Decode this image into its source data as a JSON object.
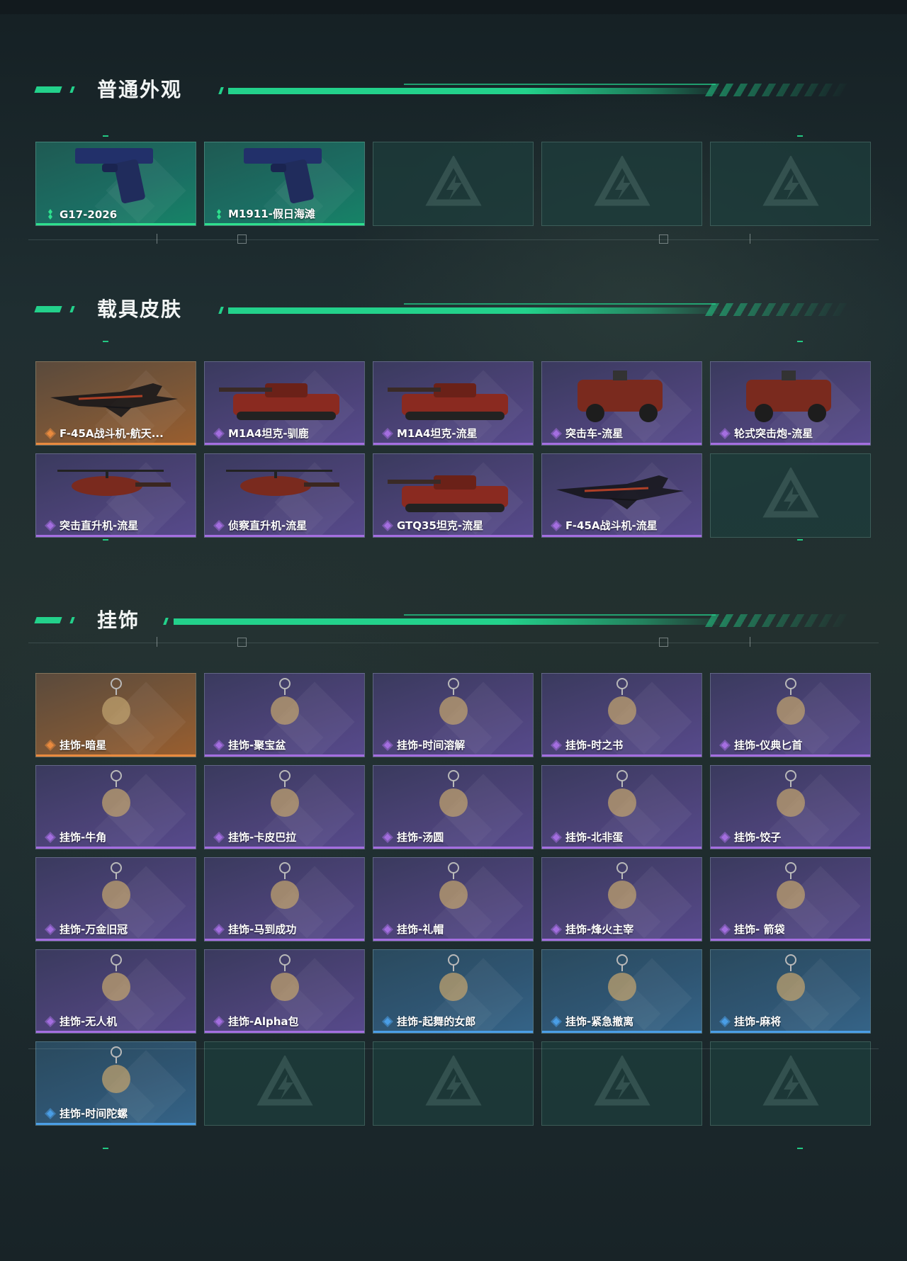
{
  "sections": [
    {
      "title": "普通外观",
      "items": [
        {
          "label": "G17-2026",
          "rarity": "green",
          "icon": "pistol-icon"
        },
        {
          "label": "M1911-假日海滩",
          "rarity": "green",
          "icon": "pistol-icon"
        }
      ],
      "empty_slots": 3
    },
    {
      "title": "载具皮肤",
      "items": [
        {
          "label": "F-45A战斗机-航天...",
          "rarity": "orange",
          "icon": "jet-icon"
        },
        {
          "label": "M1A4坦克-驯鹿",
          "rarity": "purple",
          "icon": "tank-icon"
        },
        {
          "label": "M1A4坦克-流星",
          "rarity": "purple",
          "icon": "tank-icon"
        },
        {
          "label": "突击车-流星",
          "rarity": "purple",
          "icon": "armored-car-icon"
        },
        {
          "label": "轮式突击炮-流星",
          "rarity": "purple",
          "icon": "armored-car-icon"
        },
        {
          "label": "突击直升机-流星",
          "rarity": "purple",
          "icon": "helicopter-icon"
        },
        {
          "label": "侦察直升机-流星",
          "rarity": "purple",
          "icon": "helicopter-icon"
        },
        {
          "label": "GTQ35坦克-流星",
          "rarity": "purple",
          "icon": "tank-icon"
        },
        {
          "label": "F-45A战斗机-流星",
          "rarity": "purple",
          "icon": "jet-icon"
        }
      ],
      "empty_slots": 1
    },
    {
      "title": "挂饰",
      "items": [
        {
          "label": "挂饰-暗星",
          "rarity": "orange",
          "icon": "charm-icon"
        },
        {
          "label": "挂饰-聚宝盆",
          "rarity": "purple",
          "icon": "charm-icon"
        },
        {
          "label": "挂饰-时间溶解",
          "rarity": "purple",
          "icon": "charm-icon"
        },
        {
          "label": "挂饰-时之书",
          "rarity": "purple",
          "icon": "charm-icon"
        },
        {
          "label": "挂饰-仪典匕首",
          "rarity": "purple",
          "icon": "charm-icon"
        },
        {
          "label": "挂饰-牛角",
          "rarity": "purple",
          "icon": "charm-icon"
        },
        {
          "label": "挂饰-卡皮巴拉",
          "rarity": "purple",
          "icon": "charm-icon"
        },
        {
          "label": "挂饰-汤圆",
          "rarity": "purple",
          "icon": "charm-icon"
        },
        {
          "label": "挂饰-北非蛋",
          "rarity": "purple",
          "icon": "charm-icon"
        },
        {
          "label": "挂饰-饺子",
          "rarity": "purple",
          "icon": "charm-icon"
        },
        {
          "label": "挂饰-万金旧冠",
          "rarity": "purple",
          "icon": "charm-icon"
        },
        {
          "label": "挂饰-马到成功",
          "rarity": "purple",
          "icon": "charm-icon"
        },
        {
          "label": "挂饰-礼帽",
          "rarity": "purple",
          "icon": "charm-icon"
        },
        {
          "label": "挂饰-烽火主宰",
          "rarity": "purple",
          "icon": "charm-icon"
        },
        {
          "label": "挂饰- 箭袋",
          "rarity": "purple",
          "icon": "charm-icon"
        },
        {
          "label": "挂饰-无人机",
          "rarity": "purple",
          "icon": "charm-icon"
        },
        {
          "label": "挂饰-Alpha包",
          "rarity": "purple",
          "icon": "charm-icon"
        },
        {
          "label": "挂饰-起舞的女郎",
          "rarity": "blue",
          "icon": "charm-icon"
        },
        {
          "label": "挂饰-紧急撤离",
          "rarity": "blue",
          "icon": "charm-icon"
        },
        {
          "label": "挂饰-麻将",
          "rarity": "blue",
          "icon": "charm-icon"
        },
        {
          "label": "挂饰-时间陀螺",
          "rarity": "blue",
          "icon": "charm-icon"
        }
      ],
      "empty_slots": 4
    }
  ],
  "colors": {
    "accent": "#23d18b",
    "green": "#2ee08e",
    "orange": "#e98a3e",
    "purple": "#a46ee0",
    "blue": "#4a9ee6"
  }
}
